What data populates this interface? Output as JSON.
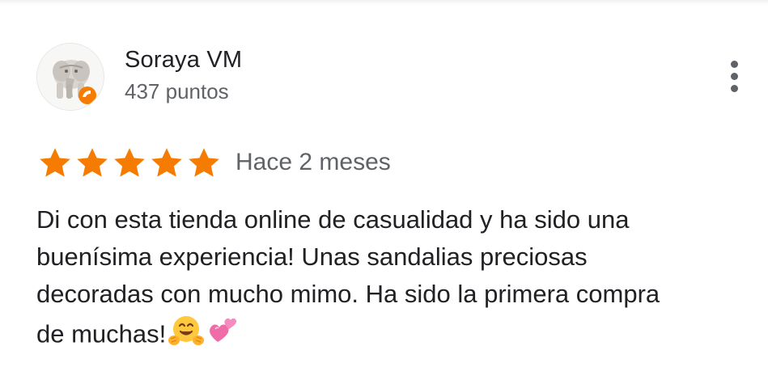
{
  "review": {
    "author": {
      "name": "Soraya VM",
      "points": "437 puntos",
      "avatar_icon": "elephant-figurine-avatar",
      "badge_color": "#f57c00"
    },
    "menu_icon": "more-vert-icon",
    "rating": {
      "stars": 5,
      "max": 5,
      "star_color": "#f57c00"
    },
    "time": "Hace 2 meses",
    "text_lines": [
      "Di con esta tienda online de casualidad y ha sido una",
      "buenísima experiencia! Unas sandalias preciosas",
      "decoradas con mucho mimo. Ha sido la primera compra",
      "de muchas!"
    ],
    "emojis": [
      "hugging-face-icon",
      "two-hearts-icon"
    ]
  }
}
